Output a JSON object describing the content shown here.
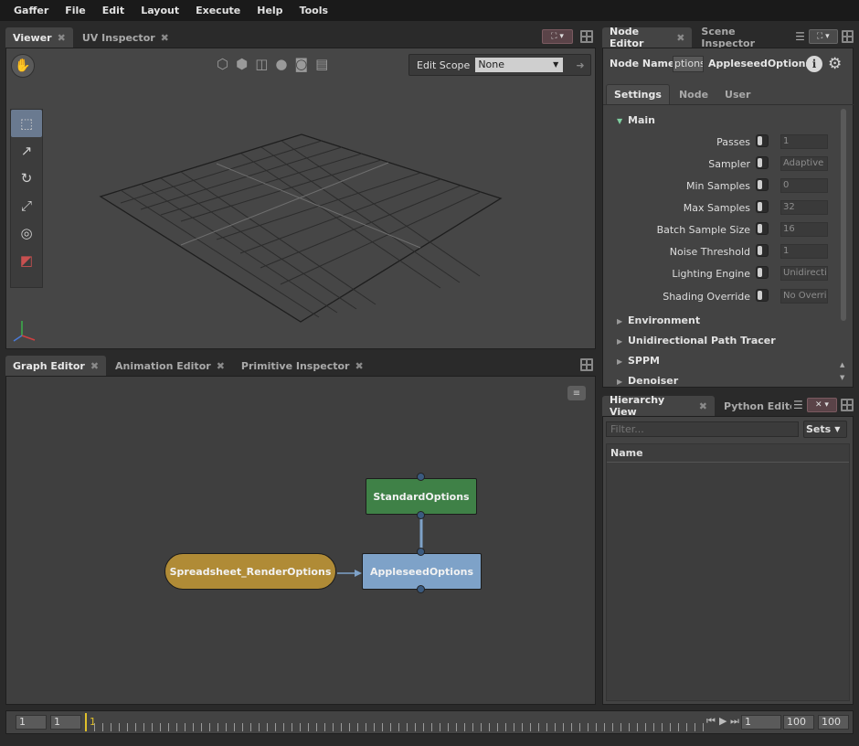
{
  "menubar": {
    "items": [
      "Gaffer",
      "File",
      "Edit",
      "Layout",
      "Execute",
      "Help",
      "Tools"
    ]
  },
  "viewer": {
    "tabs": [
      {
        "label": "Viewer"
      },
      {
        "label": "UV Inspector"
      }
    ],
    "edit_scope_label": "Edit Scope",
    "edit_scope_value": "None"
  },
  "graph": {
    "tabs": [
      {
        "label": "Graph Editor"
      },
      {
        "label": "Animation Editor"
      },
      {
        "label": "Primitive Inspector"
      }
    ],
    "nodes": {
      "standard": "StandardOptions",
      "appleseed": "AppleseedOptions",
      "spreadsheet": "Spreadsheet_RenderOptions"
    },
    "colors": {
      "standard": "#3f8147",
      "appleseed": "#7ea2c8",
      "spreadsheet": "#b08b36"
    }
  },
  "node_editor": {
    "tabs": [
      {
        "label": "Node Editor"
      },
      {
        "label": "Scene Inspector"
      }
    ],
    "node_name_label": "Node Name",
    "node_name_value": "ptions",
    "node_type": "AppleseedOptions",
    "subtabs": [
      "Settings",
      "Node",
      "User"
    ],
    "main_section": "Main",
    "rows": [
      {
        "label": "Passes",
        "value": "1"
      },
      {
        "label": "Sampler",
        "value": "Adaptive"
      },
      {
        "label": "Min Samples",
        "value": "0"
      },
      {
        "label": "Max Samples",
        "value": "32"
      },
      {
        "label": "Batch Sample Size",
        "value": "16"
      },
      {
        "label": "Noise Threshold",
        "value": "1"
      },
      {
        "label": "Lighting Engine",
        "value": "Unidirectio"
      },
      {
        "label": "Shading Override",
        "value": "No Overri"
      }
    ],
    "sections": [
      "Environment",
      "Unidirectional Path Tracer",
      "SPPM",
      "Denoiser"
    ]
  },
  "hierarchy": {
    "tabs": [
      {
        "label": "Hierarchy View"
      },
      {
        "label": "Python Editor"
      }
    ],
    "filter_placeholder": "Filter...",
    "sets_label": "Sets",
    "column_name": "Name"
  },
  "timeline": {
    "start": "1",
    "range_start": "1",
    "current_frame": "1",
    "frame_field": "1",
    "range_end": "100",
    "end": "100"
  },
  "accent_colors": {
    "frame_marker": "#e0c02a"
  }
}
